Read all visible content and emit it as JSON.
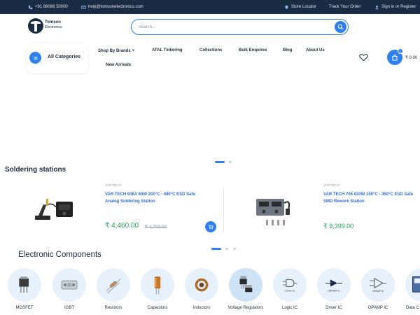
{
  "topbar": {
    "phone": "+91 88086 50000",
    "email": "help@tomsonelectronics.com",
    "store_locator": "Store Locator",
    "track_order": "Track Your Order",
    "sign_in": "Sign in or Register"
  },
  "logo": {
    "name": "Tomson",
    "sub": "Electronics"
  },
  "search": {
    "placeholder": "Search..."
  },
  "nav": {
    "all_categories": "All Categories",
    "items": [
      "Shop By Brands",
      "ATAL Tinkering",
      "Collections",
      "Bulk Enquires",
      "Blog",
      "About Us",
      "New Arrivals"
    ]
  },
  "cart": {
    "count": "0",
    "total": "₹ 0.00"
  },
  "soldering": {
    "title": "Soldering stations",
    "products": [
      {
        "vendor": "VARTECH",
        "name_line1": "VAR TECH 936A 60W 200°C - 480°C ESD Safe",
        "name_line2": "Analog Soldering Station",
        "price": "₹ 4,460.00",
        "old_price": "₹ 4,700.00"
      },
      {
        "vendor": "VARTECH",
        "name_line1": "VAR TECH 706 630W 100°C - 450°C ESD Safe",
        "name_line2": "SMD Rework Station",
        "price": "₹ 9,399.00"
      }
    ]
  },
  "components": {
    "title": "Electronic Components",
    "items": [
      {
        "label": "MOSFET",
        "icon": "mosfet-icon"
      },
      {
        "label": "IGBT",
        "icon": "igbt-icon"
      },
      {
        "label": "Resistors",
        "icon": "resistor-icon"
      },
      {
        "label": "Capacitors",
        "icon": "capacitor-icon"
      },
      {
        "label": "Inductors",
        "icon": "inductor-icon"
      },
      {
        "label": "Voltage Regulators",
        "icon": "voltage-regulator-icon"
      },
      {
        "label": "Logic IC",
        "icon": "logic-ic-icon",
        "chip": "LOGIC IC"
      },
      {
        "label": "Driver IC",
        "icon": "driver-ic-icon",
        "chip": "DRIVER IC"
      },
      {
        "label": "OPAMP IC",
        "icon": "opamp-icon",
        "chip": "OPAMP IC"
      },
      {
        "label": "Data C",
        "icon": "data-converter-icon"
      }
    ]
  },
  "colors": {
    "brand": "#2f80ed",
    "topbar": "#1a2b44",
    "price": "#22a35a",
    "link": "#2f6fd6"
  }
}
